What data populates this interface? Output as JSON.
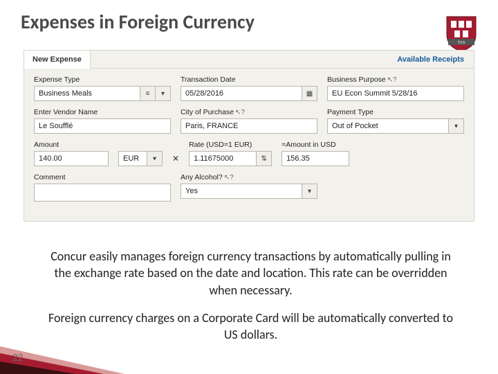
{
  "title": "Expenses in Foreign Currency",
  "crest": {
    "banner": "TAS",
    "shield": "VE RI"
  },
  "tabs": {
    "primary": "New Expense",
    "link": "Available Receipts"
  },
  "fields": {
    "expense_type": {
      "label": "Expense Type",
      "value": "Business Meals"
    },
    "transaction_date": {
      "label": "Transaction Date",
      "value": "05/28/2016"
    },
    "business_purpose": {
      "label": "Business Purpose",
      "value": "EU Econ Summit 5/28/16"
    },
    "vendor": {
      "label": "Enter Vendor Name",
      "value": "Le Soufflé"
    },
    "city": {
      "label": "City of Purchase",
      "value": "Paris, FRANCE"
    },
    "payment_type": {
      "label": "Payment Type",
      "value": "Out of Pocket"
    },
    "amount": {
      "label": "Amount",
      "value": "140.00",
      "currency": "EUR"
    },
    "rate": {
      "label": "Rate (USD=1 EUR)",
      "value": "1.11675000"
    },
    "amount_usd": {
      "label": "=Amount in USD",
      "value": "156.35"
    },
    "comment": {
      "label": "Comment",
      "value": ""
    },
    "alcohol": {
      "label": "Any Alcohol?",
      "value": "Yes"
    }
  },
  "caption": {
    "p1": "Concur easily manages foreign currency transactions by automatically pulling in the exchange rate based on the date and location. This rate can be overridden when necessary.",
    "p2": "Foreign currency charges on a Corporate Card will be automatically converted to US dollars."
  },
  "page_number": "22"
}
